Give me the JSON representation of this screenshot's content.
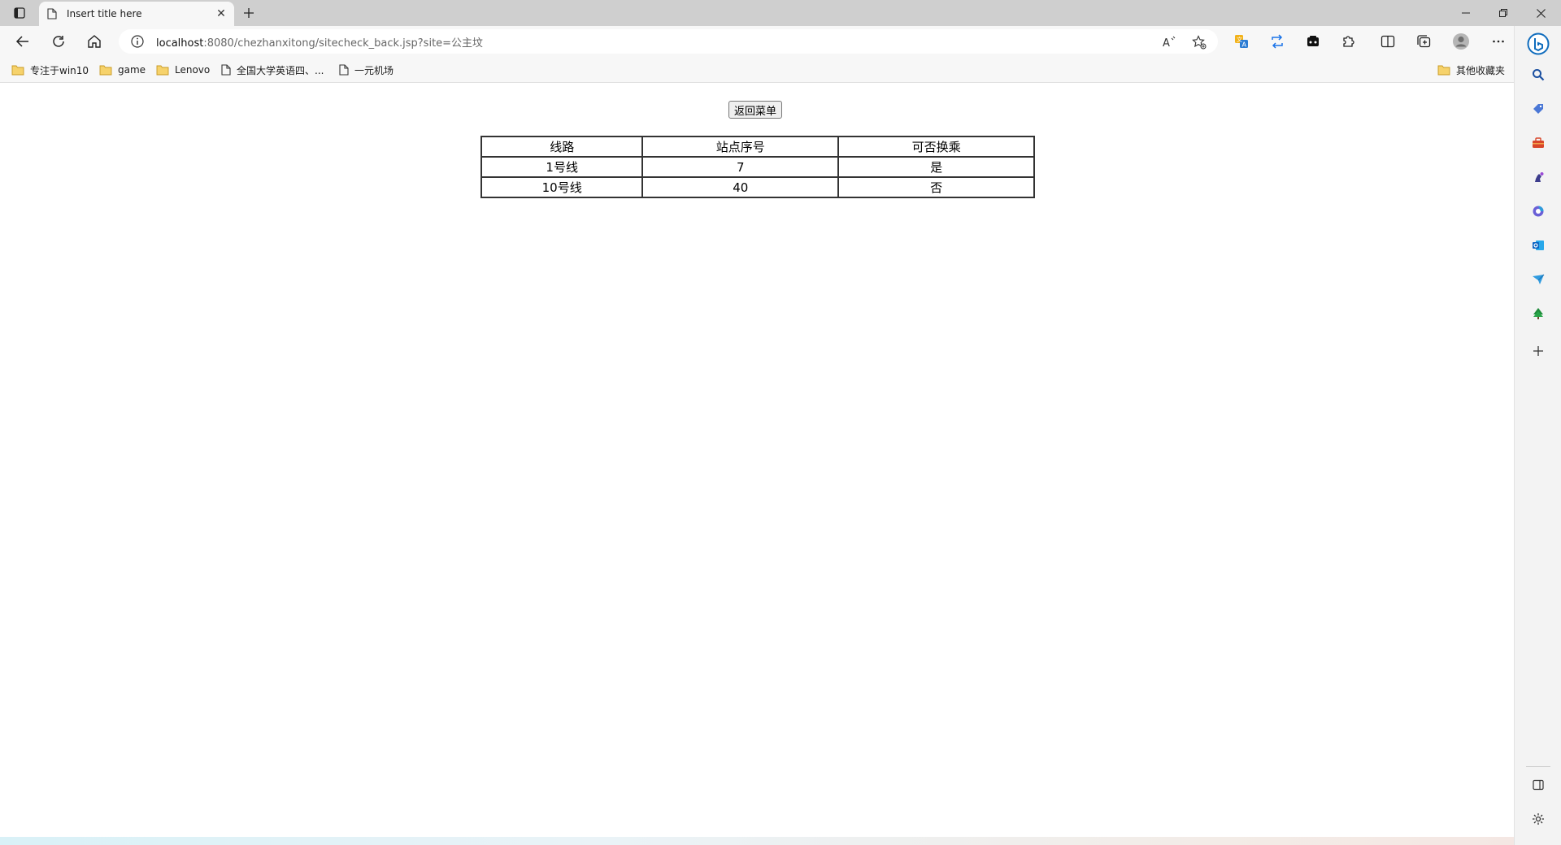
{
  "browser": {
    "tab": {
      "title": "Insert title here"
    },
    "address_bar": {
      "url_host": "localhost",
      "url_rest": ":8080/chezhanxitong/sitecheck_back.jsp?site=公主坟"
    },
    "favorites": [
      {
        "label": "专注于win10",
        "icon": "folder-icon"
      },
      {
        "label": "game",
        "icon": "folder-icon"
      },
      {
        "label": "Lenovo",
        "icon": "folder-icon"
      },
      {
        "label": "全国大学英语四、...",
        "icon": "page-icon"
      },
      {
        "label": "一元机场",
        "icon": "page-icon"
      }
    ],
    "other_favorites": "其他收藏夹"
  },
  "page": {
    "back_button": "返回菜单",
    "table": {
      "headers": [
        "线路",
        "站点序号",
        "可否换乘"
      ],
      "rows": [
        [
          "1号线",
          "7",
          "是"
        ],
        [
          "10号线",
          "40",
          "否"
        ]
      ]
    }
  },
  "colors": {
    "accent_blue": "#0f6cbd",
    "tabstrip": "#cfcfcf",
    "toolbar": "#f7f7f7",
    "table_border": "#333333"
  }
}
